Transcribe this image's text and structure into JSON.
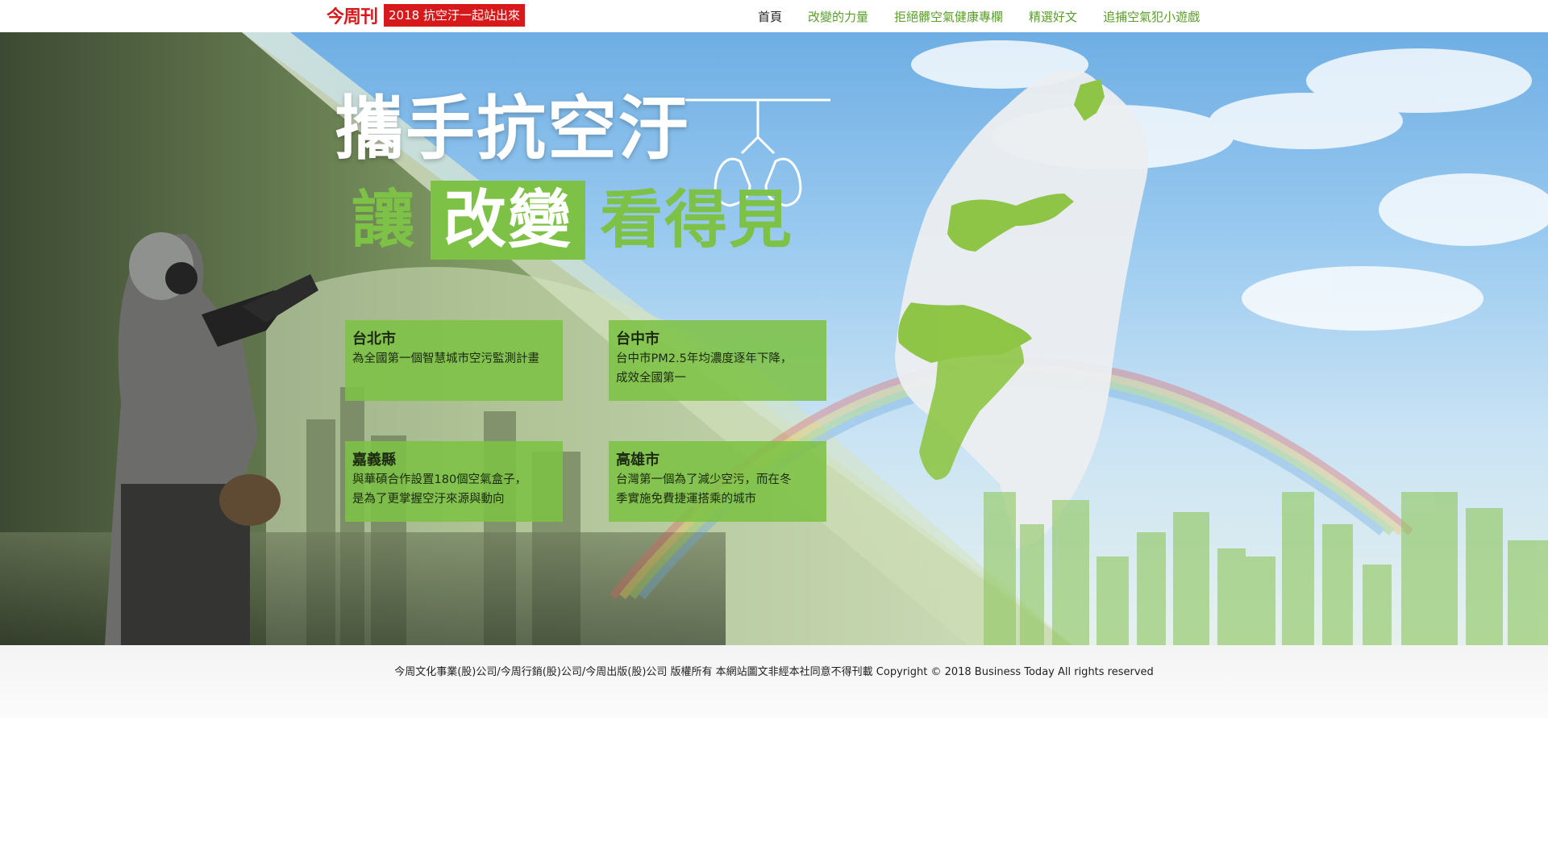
{
  "header": {
    "logo_text": "今周刊",
    "tagline": "2018 抗空汙一起站出來",
    "nav": [
      "首頁",
      "改變的力量",
      "拒絕髒空氣健康專欄",
      "精選好文",
      "追捕空氣犯小遊戲"
    ]
  },
  "hero": {
    "title_line1": "攜手抗空汙",
    "title_line2_before": "讓",
    "title_line2_highlight": "改變",
    "title_line2_after": "看得見",
    "cards": [
      {
        "title": "台北市",
        "desc": "為全國第一個智慧城市空污監測計畫"
      },
      {
        "title": "台中市",
        "desc": "台中市PM2.5年均濃度逐年下降，\n成效全國第一"
      },
      {
        "title": "嘉義縣",
        "desc": "與華碩合作設置180個空氣盒子，\n是為了更掌握空汙來源與動向"
      },
      {
        "title": "高雄市",
        "desc": "台灣第一個為了減少空污，而在冬\n季實施免費捷運搭乘的城市"
      }
    ]
  },
  "footer": {
    "copyright": "今周文化事業(股)公司/今周行銷(股)公司/今周出版(股)公司 版權所有 本網站圖文非經本社同意不得刊載 Copyright © 2018 Business Today All rights reserved"
  },
  "colors": {
    "brand_red": "#d8191b",
    "accent_green": "#7dc146",
    "nav_green": "#5a9e2c"
  }
}
